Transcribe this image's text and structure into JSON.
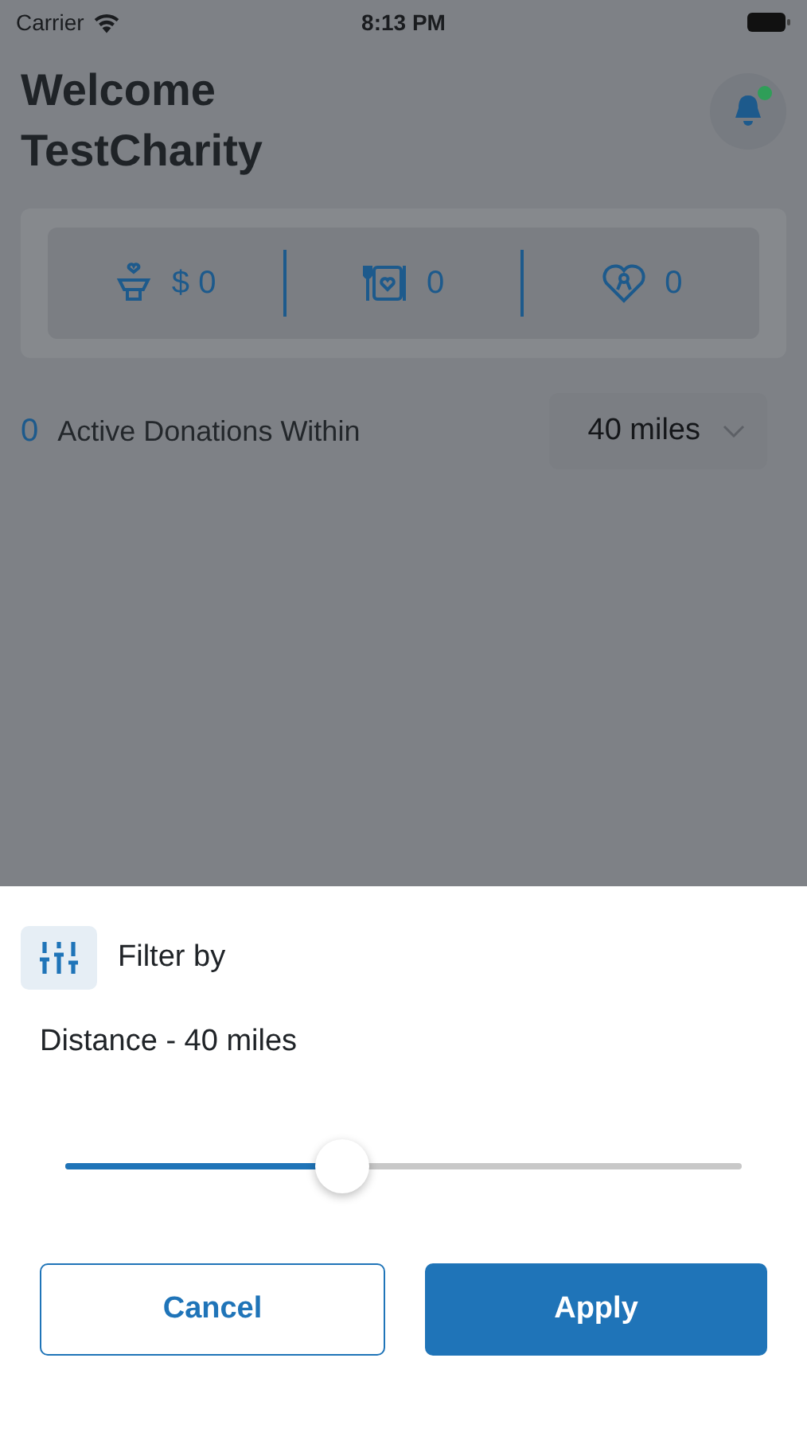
{
  "status_bar": {
    "carrier": "Carrier",
    "time": "8:13 PM"
  },
  "header": {
    "title_lines": [
      "Welcome",
      "TestCharity"
    ],
    "notification_unread": true
  },
  "stats": [
    {
      "kind": "donation",
      "value": "$ 0"
    },
    {
      "kind": "meal",
      "value": "0"
    },
    {
      "kind": "ribbon",
      "value": "0"
    }
  ],
  "active_donations": {
    "count": "0",
    "label": "Active Donations Within",
    "distance": "40 miles"
  },
  "filter_sheet": {
    "title": "Filter by",
    "label": "Distance - 40 miles",
    "slider": {
      "level": 0.41
    },
    "buttons": [
      {
        "kind": "secondary",
        "label": "Cancel"
      },
      {
        "kind": "primary",
        "label": "Apply"
      }
    ]
  }
}
